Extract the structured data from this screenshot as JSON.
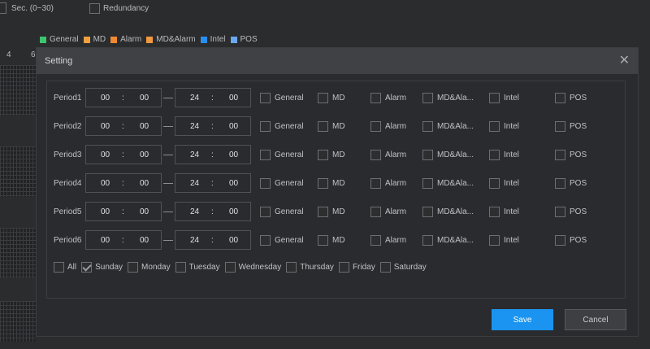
{
  "background": {
    "sec_label": "Sec. (0~30)",
    "redundancy_label": "Redundancy",
    "ruler_ticks": [
      "4",
      "6"
    ],
    "legend": [
      {
        "label": "General",
        "color": "#3ec46d"
      },
      {
        "label": "MD",
        "color": "#f0a040"
      },
      {
        "label": "Alarm",
        "color": "#f08a30"
      },
      {
        "label": "MD&Alarm",
        "color": "#f09a40"
      },
      {
        "label": "Intel",
        "color": "#2a8ef0"
      },
      {
        "label": "POS",
        "color": "#6aa8f0"
      }
    ]
  },
  "dialog": {
    "title": "Setting",
    "close_icon": "close-icon",
    "periods": [
      {
        "label": "Period1",
        "start_h": "00",
        "start_m": "00",
        "end_h": "24",
        "end_m": "00"
      },
      {
        "label": "Period2",
        "start_h": "00",
        "start_m": "00",
        "end_h": "24",
        "end_m": "00"
      },
      {
        "label": "Period3",
        "start_h": "00",
        "start_m": "00",
        "end_h": "24",
        "end_m": "00"
      },
      {
        "label": "Period4",
        "start_h": "00",
        "start_m": "00",
        "end_h": "24",
        "end_m": "00"
      },
      {
        "label": "Period5",
        "start_h": "00",
        "start_m": "00",
        "end_h": "24",
        "end_m": "00"
      },
      {
        "label": "Period6",
        "start_h": "00",
        "start_m": "00",
        "end_h": "24",
        "end_m": "00"
      }
    ],
    "time_sep": ":",
    "types": [
      "General",
      "MD",
      "Alarm",
      "MD&Ala...",
      "Intel",
      "POS"
    ],
    "days": [
      {
        "label": "All",
        "checked": false
      },
      {
        "label": "Sunday",
        "checked": true
      },
      {
        "label": "Monday",
        "checked": false
      },
      {
        "label": "Tuesday",
        "checked": false
      },
      {
        "label": "Wednesday",
        "checked": false
      },
      {
        "label": "Thursday",
        "checked": false
      },
      {
        "label": "Friday",
        "checked": false
      },
      {
        "label": "Saturday",
        "checked": false
      }
    ],
    "save_label": "Save",
    "cancel_label": "Cancel"
  }
}
